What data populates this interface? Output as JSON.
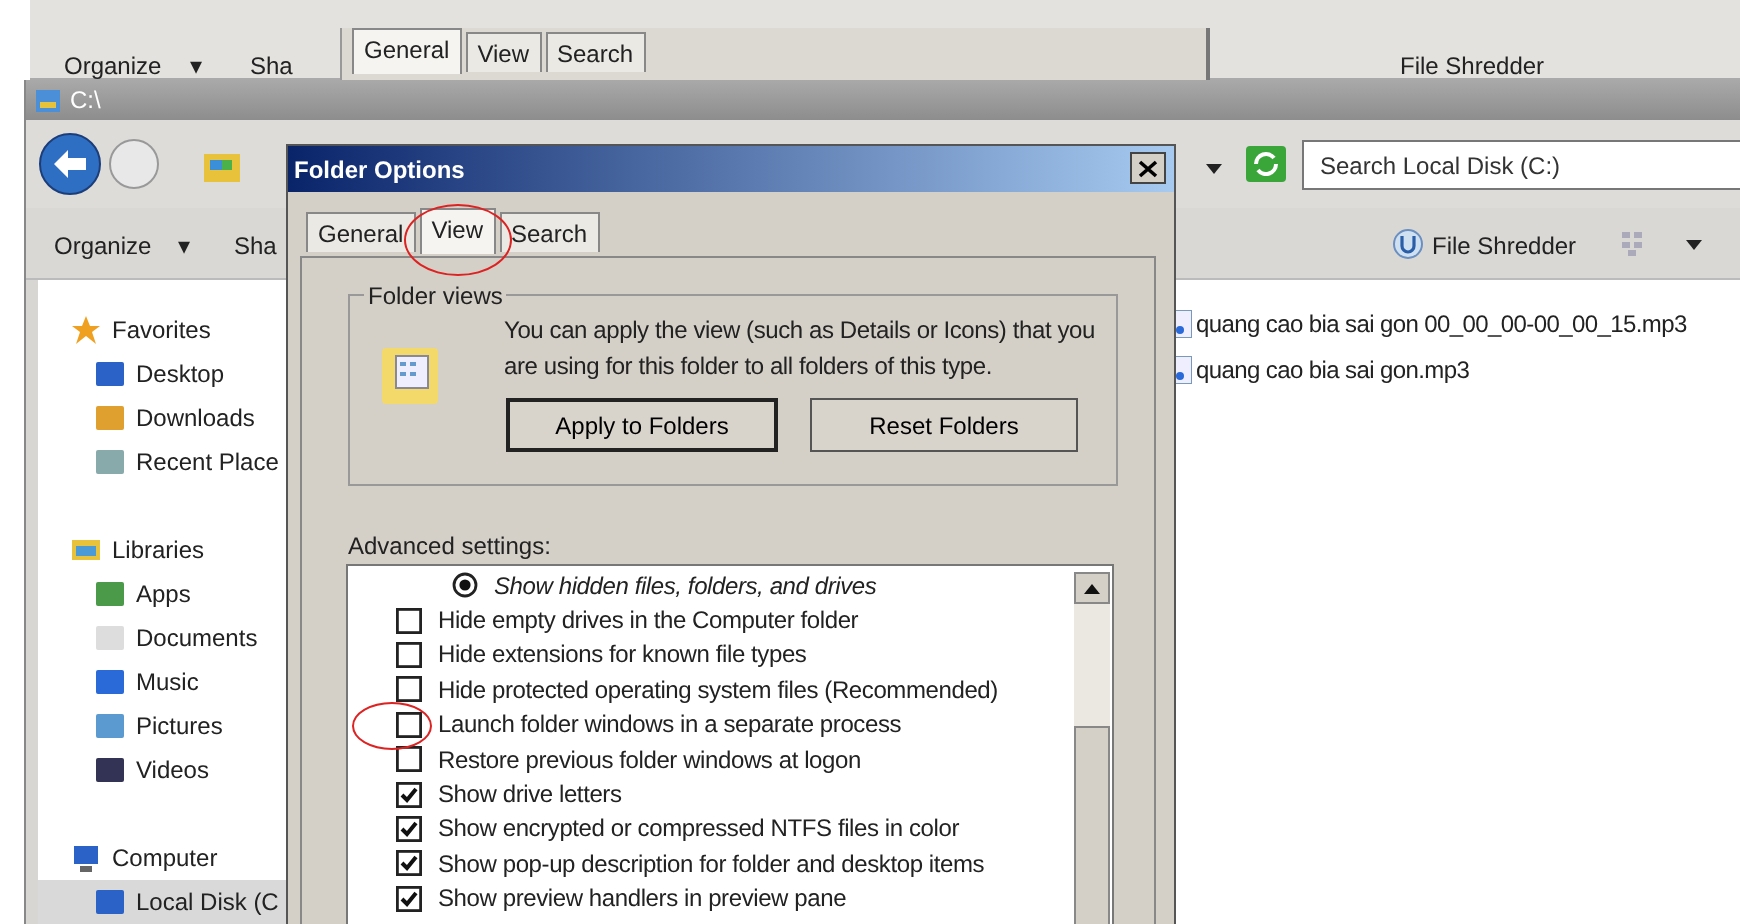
{
  "back_window": {
    "organize": "Organize",
    "organize_caret": "▾",
    "share": "Sha",
    "tabs": [
      {
        "label": "General",
        "selected": true
      },
      {
        "label": "View",
        "selected": false
      },
      {
        "label": "Search",
        "selected": false
      }
    ],
    "shredder": "File Shredder"
  },
  "explorer": {
    "title": "C:\\",
    "search": {
      "placeholder": "Search Local Disk (C:)"
    },
    "organize": "Organize",
    "organize_caret": "▾",
    "share": "Sha",
    "shredder": "File Shredder",
    "nav": [
      {
        "label": "Favorites",
        "children": [
          {
            "label": "Desktop",
            "selected": false
          },
          {
            "label": "Downloads",
            "selected": false
          },
          {
            "label": "Recent Place",
            "selected": false
          }
        ]
      },
      {
        "label": "Libraries",
        "children": [
          {
            "label": "Apps",
            "selected": false
          },
          {
            "label": "Documents",
            "selected": false
          },
          {
            "label": "Music",
            "selected": false
          },
          {
            "label": "Pictures",
            "selected": false
          },
          {
            "label": "Videos",
            "selected": false
          }
        ]
      },
      {
        "label": "Computer",
        "children": [
          {
            "label": "Local Disk (C",
            "selected": true
          }
        ]
      }
    ],
    "files": [
      "quang cao bia sai gon 00_00_00-00_00_15.mp3",
      "quang cao bia sai gon.mp3"
    ]
  },
  "dialog": {
    "title": "Folder Options",
    "tabs": [
      {
        "label": "General",
        "selected": false,
        "circled": false
      },
      {
        "label": "View",
        "selected": true,
        "circled": true
      },
      {
        "label": "Search",
        "selected": false,
        "circled": false
      }
    ],
    "folder_views": {
      "legend": "Folder views",
      "text": "You can apply the view (such as Details or Icons) that you are using for this folder to all folders of this type.",
      "buttons": [
        {
          "label": "Apply to Folders",
          "default": true
        },
        {
          "label": "Reset Folders",
          "default": false
        }
      ]
    },
    "advanced_label": "Advanced settings:",
    "settings": [
      {
        "kind": "radio",
        "label": "Show hidden files, folders, and drives",
        "checked": true,
        "circled": false
      },
      {
        "kind": "checkbox",
        "label": "Hide empty drives in the Computer folder",
        "checked": false,
        "circled": false
      },
      {
        "kind": "checkbox",
        "label": "Hide extensions for known file types",
        "checked": false,
        "circled": false
      },
      {
        "kind": "checkbox",
        "label": "Hide protected operating system files (Recommended)",
        "checked": false,
        "circled": false
      },
      {
        "kind": "checkbox",
        "label": "Launch folder windows in a separate process",
        "checked": false,
        "circled": true
      },
      {
        "kind": "checkbox",
        "label": "Restore previous folder windows at logon",
        "checked": false,
        "circled": false
      },
      {
        "kind": "checkbox",
        "label": "Show drive letters",
        "checked": true,
        "circled": false
      },
      {
        "kind": "checkbox",
        "label": "Show encrypted or compressed NTFS files in color",
        "checked": true,
        "circled": false
      },
      {
        "kind": "checkbox",
        "label": "Show pop-up description for folder and desktop items",
        "checked": true,
        "circled": false
      },
      {
        "kind": "checkbox",
        "label": "Show preview handlers in preview pane",
        "checked": true,
        "circled": false
      }
    ]
  }
}
